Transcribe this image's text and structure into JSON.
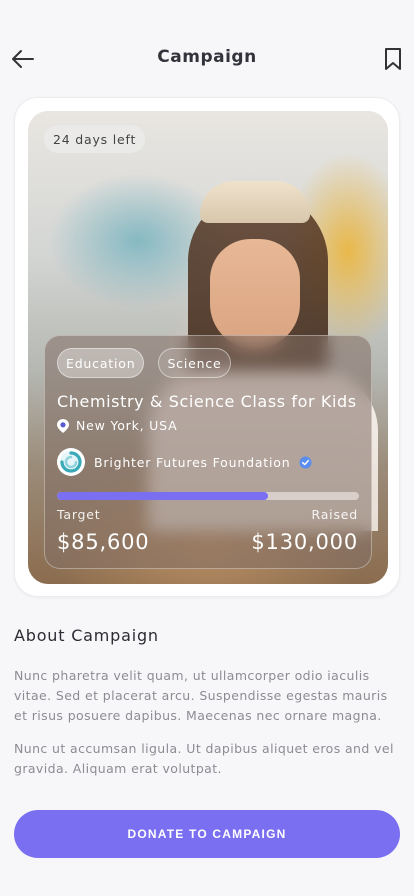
{
  "header": {
    "title": "Campaign",
    "back_icon": "arrow-left-icon",
    "bookmark_icon": "bookmark-icon"
  },
  "campaign": {
    "days_left": "24 days left",
    "tags": [
      "Education",
      "Science"
    ],
    "title": "Chemistry & Science Class for Kids",
    "location": "New York, USA",
    "organization": "Brighter Futures Foundation",
    "verified": true,
    "progress": 0.7,
    "target_label": "Target",
    "target_value": "$85,600",
    "raised_label": "Raised",
    "raised_value": "$130,000"
  },
  "about": {
    "title": "About Campaign",
    "paragraphs": [
      "Nunc pharetra velit quam, ut ullamcorper odio iaculis vitae. Sed et placerat arcu. Suspendisse egestas mauris et risus posuere dapibus. Maecenas nec ornare magna.",
      "Nunc ut accumsan ligula. Ut dapibus aliquet eros and vel gravida. Aliquam erat volutpat."
    ]
  },
  "cta": {
    "label": "DONATE TO CAMPAIGN"
  },
  "colors": {
    "accent": "#7a6ff0",
    "verified_badge": "#5b8dee",
    "org_logo": "#3aa9b8"
  }
}
